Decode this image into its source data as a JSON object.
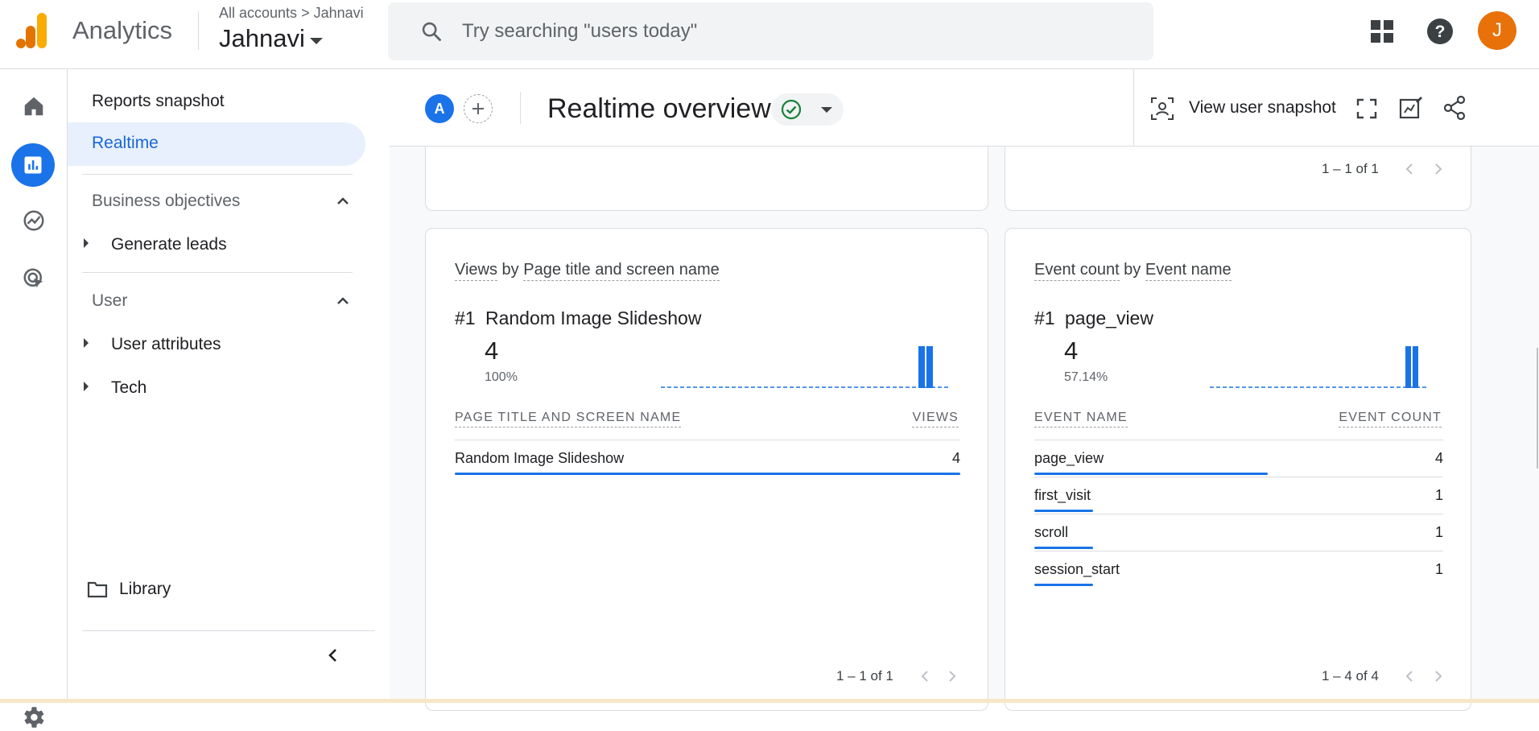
{
  "app": {
    "name": "Analytics"
  },
  "breadcrumb": {
    "all_accounts": "All accounts",
    "sep": ">",
    "account": "Jahnavi"
  },
  "account_name": "Jahnavi",
  "search": {
    "placeholder": "Try searching \"users today\""
  },
  "user": {
    "avatar_letter": "J",
    "avatar_color": "#e8710a"
  },
  "nav": {
    "reports_snapshot": "Reports snapshot",
    "realtime": "Realtime",
    "business_objectives": "Business objectives",
    "generate_leads": "Generate leads",
    "user_section": "User",
    "user_attributes": "User attributes",
    "tech": "Tech",
    "library": "Library"
  },
  "header": {
    "comparison_chip": "A",
    "title": "Realtime overview",
    "view_user_snapshot": "View user snapshot"
  },
  "top_cards": {
    "right_pager": "1 – 1 of 1"
  },
  "views_card": {
    "title_part1": "Views",
    "title_by": " by ",
    "title_part2": "Page title and screen name",
    "rank": "#1",
    "top_item": "Random Image Slideshow",
    "top_value": "4",
    "top_pct": "100%",
    "col_name": "PAGE TITLE AND SCREEN NAME",
    "col_value": "VIEWS",
    "rows": [
      {
        "name": "Random Image Slideshow",
        "value": "4",
        "share": 1.0
      }
    ],
    "pager": "1 – 1 of 1"
  },
  "events_card": {
    "title_part1": "Event count",
    "title_by": " by ",
    "title_part2": "Event name",
    "rank": "#1",
    "top_item": "page_view",
    "top_value": "4",
    "top_pct": "57.14%",
    "col_name": "EVENT NAME",
    "col_value": "EVENT COUNT",
    "rows": [
      {
        "name": "page_view",
        "value": "4",
        "share": 0.5714
      },
      {
        "name": "first_visit",
        "value": "1",
        "share": 0.1429
      },
      {
        "name": "scroll",
        "value": "1",
        "share": 0.1429
      },
      {
        "name": "session_start",
        "value": "1",
        "share": 0.1429
      }
    ],
    "pager": "1 – 4 of 4"
  },
  "colors": {
    "accent": "#1a73e8",
    "active_nav_bg": "#e8f0fe",
    "logo_orange": "#f9ab00",
    "logo_dark": "#e37400"
  }
}
